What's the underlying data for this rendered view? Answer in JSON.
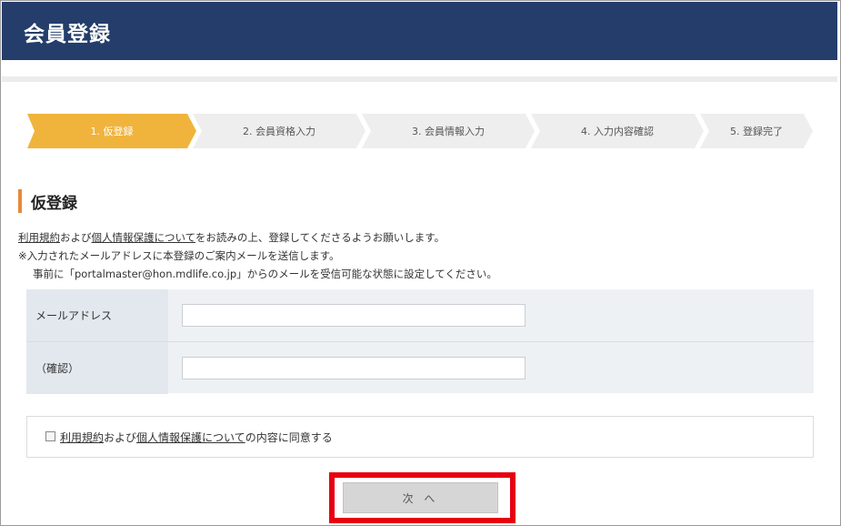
{
  "header": {
    "title": "会員登録"
  },
  "steps": [
    {
      "label": "1. 仮登録",
      "active": true
    },
    {
      "label": "2. 会員資格入力",
      "active": false
    },
    {
      "label": "3. 会員情報入力",
      "active": false
    },
    {
      "label": "4. 入力内容確認",
      "active": false
    },
    {
      "label": "5. 登録完了",
      "active": false
    }
  ],
  "colors": {
    "header_bg": "#243d6b",
    "active_step": "#f0b43c",
    "inactive_step": "#eeeeee",
    "accent_bar": "#e8893a",
    "highlight": "#e60012"
  },
  "section": {
    "title": "仮登録",
    "notice1_link1": "利用規約",
    "notice1_mid": "および",
    "notice1_link2": "個人情報保護について",
    "notice1_rest": "をお読みの上、登録してくださるようお願いします。",
    "notice2": "※入力されたメールアドレスに本登録のご案内メールを送信します。",
    "notice3": "事前に「portalmaster@hon.mdlife.co.jp」からのメールを受信可能な状態に設定してください。"
  },
  "form": {
    "email_label": "メールアドレス",
    "email_value": "",
    "confirm_label": "（確認）",
    "confirm_value": ""
  },
  "agree": {
    "link1": "利用規約",
    "mid": "および",
    "link2": "個人情報保護について",
    "rest": "の内容に同意する",
    "checked": false
  },
  "next_button": {
    "label": "次 へ"
  }
}
